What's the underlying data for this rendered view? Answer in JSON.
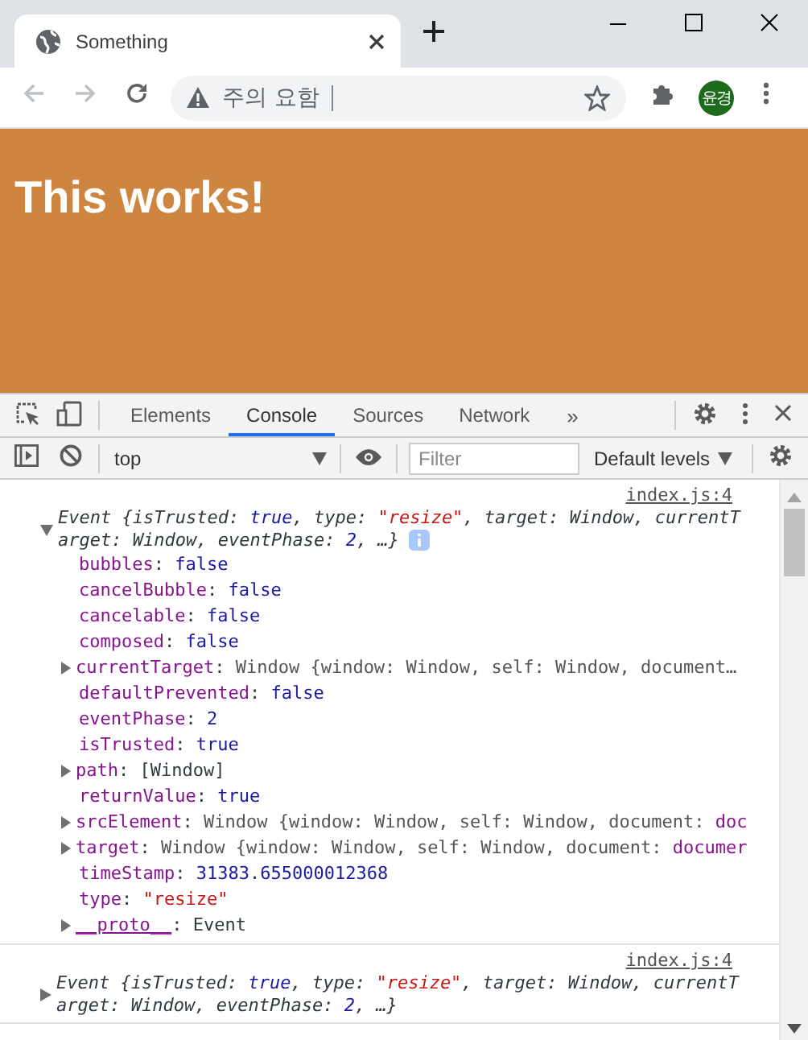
{
  "browser": {
    "tab": {
      "title": "Something",
      "selected": true
    },
    "address": {
      "security": "주의 요함"
    },
    "profile": "윤경"
  },
  "page": {
    "heading": "This works!"
  },
  "devtools": {
    "tabs": [
      {
        "label": "Elements",
        "selected": false
      },
      {
        "label": "Console",
        "selected": true
      },
      {
        "label": "Sources",
        "selected": false
      },
      {
        "label": "Network",
        "selected": false
      }
    ],
    "more": "»"
  },
  "console_toolbar": {
    "context": "top",
    "filter": {
      "placeholder": "Filter"
    },
    "levels": "Default levels"
  },
  "messages": [
    {
      "source": "index.js:4",
      "expanded": true,
      "summary": [
        [
          {
            "kind": "text",
            "text": "Event {isTrusted: "
          },
          {
            "kind": "bool",
            "text": "true"
          },
          {
            "kind": "text",
            "text": ", type: "
          },
          {
            "kind": "string",
            "text": "\"resize\""
          },
          {
            "kind": "text",
            "text": ", target: Window, currentT"
          }
        ],
        [
          {
            "kind": "text",
            "text": "arget: Window, eventPhase: "
          },
          {
            "kind": "number",
            "text": "2"
          },
          {
            "kind": "text",
            "text": ", …}"
          }
        ]
      ],
      "properties": [
        {
          "expandable": false,
          "segments": [
            {
              "kind": "key",
              "text": "bubbles"
            },
            {
              "kind": "plain",
              "text": ": "
            },
            {
              "kind": "bool",
              "text": "false"
            }
          ]
        },
        {
          "expandable": false,
          "segments": [
            {
              "kind": "key",
              "text": "cancelBubble"
            },
            {
              "kind": "plain",
              "text": ": "
            },
            {
              "kind": "bool",
              "text": "false"
            }
          ]
        },
        {
          "expandable": false,
          "segments": [
            {
              "kind": "key",
              "text": "cancelable"
            },
            {
              "kind": "plain",
              "text": ": "
            },
            {
              "kind": "bool",
              "text": "false"
            }
          ]
        },
        {
          "expandable": false,
          "segments": [
            {
              "kind": "key",
              "text": "composed"
            },
            {
              "kind": "plain",
              "text": ": "
            },
            {
              "kind": "bool",
              "text": "false"
            }
          ]
        },
        {
          "expandable": true,
          "segments": [
            {
              "kind": "key",
              "text": "currentTarget"
            },
            {
              "kind": "plain",
              "text": ": "
            },
            {
              "kind": "preview",
              "text": "Window {window: Window, self: Window, document…"
            }
          ]
        },
        {
          "expandable": false,
          "segments": [
            {
              "kind": "key",
              "text": "defaultPrevented"
            },
            {
              "kind": "plain",
              "text": ": "
            },
            {
              "kind": "bool",
              "text": "false"
            }
          ]
        },
        {
          "expandable": false,
          "segments": [
            {
              "kind": "key",
              "text": "eventPhase"
            },
            {
              "kind": "plain",
              "text": ": "
            },
            {
              "kind": "number",
              "text": "2"
            }
          ]
        },
        {
          "expandable": false,
          "segments": [
            {
              "kind": "key",
              "text": "isTrusted"
            },
            {
              "kind": "plain",
              "text": ": "
            },
            {
              "kind": "bool",
              "text": "true"
            }
          ]
        },
        {
          "expandable": true,
          "segments": [
            {
              "kind": "key",
              "text": "path"
            },
            {
              "kind": "plain",
              "text": ": [Window]"
            }
          ]
        },
        {
          "expandable": false,
          "segments": [
            {
              "kind": "key",
              "text": "returnValue"
            },
            {
              "kind": "plain",
              "text": ": "
            },
            {
              "kind": "bool",
              "text": "true"
            }
          ]
        },
        {
          "expandable": true,
          "segments": [
            {
              "kind": "key",
              "text": "srcElement"
            },
            {
              "kind": "plain",
              "text": ": "
            },
            {
              "kind": "preview",
              "text": "Window {window: Window, self: Window, document: "
            },
            {
              "kind": "key",
              "text": "doc"
            }
          ]
        },
        {
          "expandable": true,
          "segments": [
            {
              "kind": "key",
              "text": "target"
            },
            {
              "kind": "plain",
              "text": ": "
            },
            {
              "kind": "preview",
              "text": "Window {window: Window, self: Window, document: "
            },
            {
              "kind": "key",
              "text": "documer"
            }
          ]
        },
        {
          "expandable": false,
          "segments": [
            {
              "kind": "key",
              "text": "timeStamp"
            },
            {
              "kind": "plain",
              "text": ": "
            },
            {
              "kind": "number",
              "text": "31383.655000012368"
            }
          ]
        },
        {
          "expandable": false,
          "segments": [
            {
              "kind": "key",
              "text": "type"
            },
            {
              "kind": "plain",
              "text": ": "
            },
            {
              "kind": "string",
              "text": "\"resize\""
            }
          ]
        },
        {
          "expandable": true,
          "segments": [
            {
              "kind": "proto",
              "text": "__proto__"
            },
            {
              "kind": "plain",
              "text": ": Event"
            }
          ]
        }
      ]
    },
    {
      "source": "index.js:4",
      "expanded": false,
      "summary": [
        [
          {
            "kind": "text",
            "text": "Event {isTrusted: "
          },
          {
            "kind": "bool",
            "text": "true"
          },
          {
            "kind": "text",
            "text": ", type: "
          },
          {
            "kind": "string",
            "text": "\"resize\""
          },
          {
            "kind": "text",
            "text": ", target: Window, currentT"
          }
        ],
        [
          {
            "kind": "text",
            "text": "arget: Window, eventPhase: "
          },
          {
            "kind": "number",
            "text": "2"
          },
          {
            "kind": "text",
            "text": ", …}"
          }
        ]
      ]
    }
  ]
}
